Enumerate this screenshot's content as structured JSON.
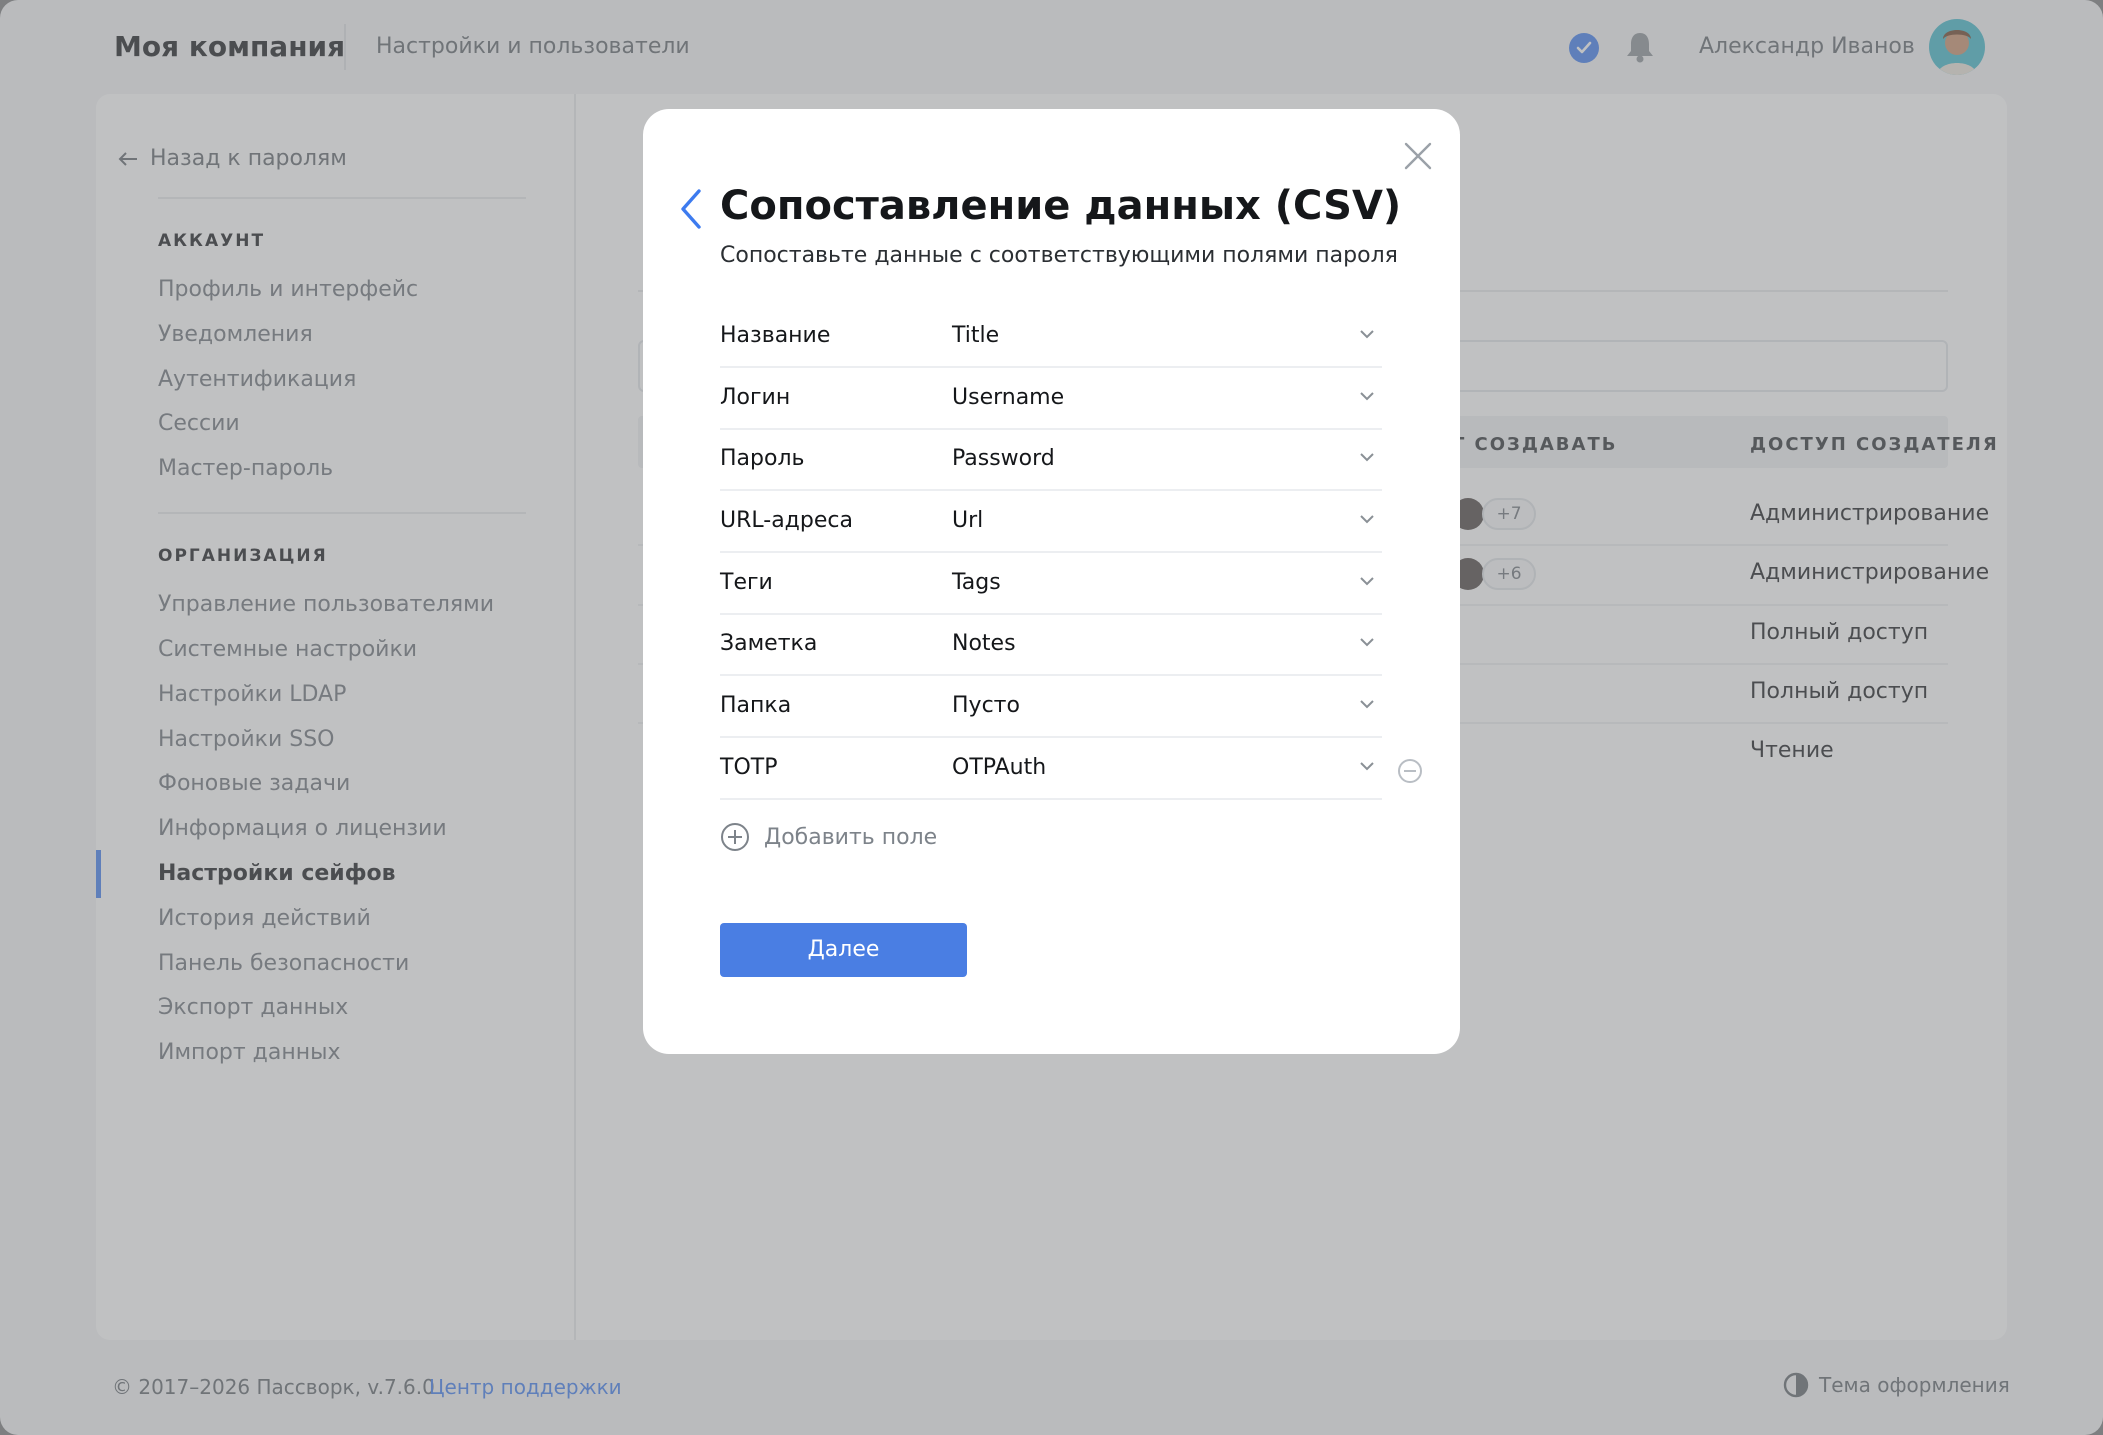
{
  "header": {
    "brand": "Моя компания",
    "subtitle": "Настройки и пользователи",
    "user_name": "Александр Иванов"
  },
  "sidebar": {
    "back_label": "Назад к паролям",
    "account_heading": "АККАУНТ",
    "account_items": [
      {
        "label": "Профиль и интерфейс"
      },
      {
        "label": "Уведомления"
      },
      {
        "label": "Аутентификация"
      },
      {
        "label": "Сессии"
      },
      {
        "label": "Мастер-пароль"
      }
    ],
    "org_heading": "ОРГАНИЗАЦИЯ",
    "org_items": [
      {
        "label": "Управление пользователями"
      },
      {
        "label": "Системные настройки"
      },
      {
        "label": "Настройки LDAP"
      },
      {
        "label": "Настройки SSO"
      },
      {
        "label": "Фоновые задачи"
      },
      {
        "label": "Информация о лицензии"
      },
      {
        "label": "Настройки сейфов",
        "active": true
      },
      {
        "label": "История действий"
      },
      {
        "label": "Панель безопасности"
      },
      {
        "label": "Экспорт данных"
      },
      {
        "label": "Импорт данных"
      }
    ]
  },
  "table": {
    "col_create": "Т СОЗДАВАТЬ",
    "col_access": "ДОСТУП СОЗДАТЕЛЯ",
    "rows": [
      {
        "badge": "+7",
        "access": "Администрирование"
      },
      {
        "badge": "+6",
        "access": "Администрирование"
      },
      {
        "badge": "",
        "access": "Полный доступ"
      },
      {
        "badge": "",
        "access": "Полный доступ"
      },
      {
        "badge": "",
        "access": "Чтение"
      }
    ]
  },
  "footer": {
    "copyright": "© 2017–2026 Пассворк, v.7.6.0",
    "support_link": "Центр поддержки",
    "theme_label": "Тема оформления"
  },
  "modal": {
    "title": "Сопоставление данных (CSV)",
    "subtitle": "Сопоставьте данные с соответствующими полями пароля",
    "fields": [
      {
        "label": "Название",
        "value": "Title"
      },
      {
        "label": "Логин",
        "value": "Username"
      },
      {
        "label": "Пароль",
        "value": "Password"
      },
      {
        "label": "URL-адреса",
        "value": "Url"
      },
      {
        "label": "Теги",
        "value": "Tags"
      },
      {
        "label": "Заметка",
        "value": "Notes"
      },
      {
        "label": "Папка",
        "value": "Пусто"
      },
      {
        "label": "TOTP",
        "value": "OTPAuth"
      }
    ],
    "add_field_label": "Добавить поле",
    "next_button": "Далее"
  },
  "colors": {
    "accent": "#3d7bef",
    "button": "#4a7ee3",
    "overlay": "#828385"
  }
}
